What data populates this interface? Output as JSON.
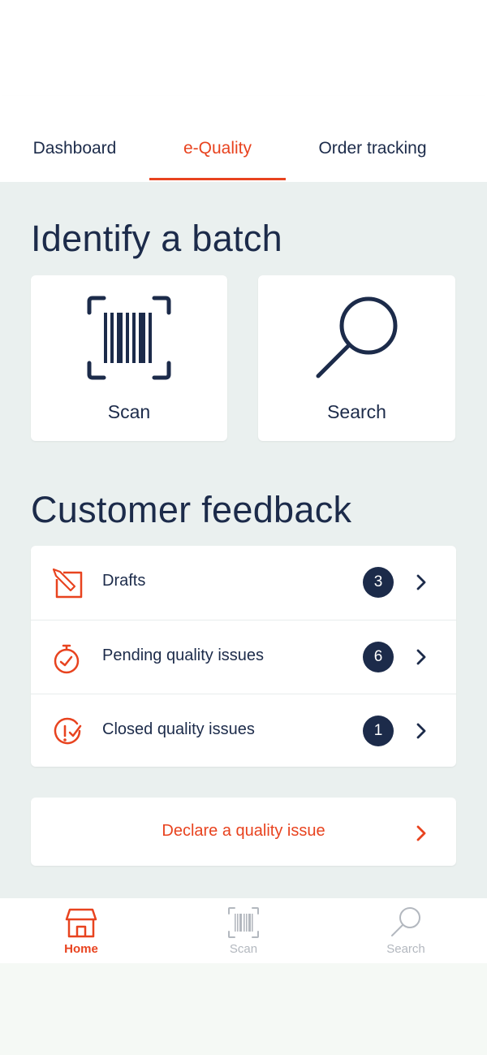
{
  "tabs": [
    {
      "label": "Dashboard",
      "active": false
    },
    {
      "label": "e-Quality",
      "active": true
    },
    {
      "label": "Order tracking",
      "active": false
    }
  ],
  "identify": {
    "title": "Identify a batch",
    "tiles": [
      {
        "label": "Scan",
        "icon": "barcode-scan-icon"
      },
      {
        "label": "Search",
        "icon": "magnifier-icon"
      }
    ]
  },
  "feedback": {
    "title": "Customer feedback",
    "items": [
      {
        "label": "Drafts",
        "count": "3",
        "icon": "draft-edit-icon"
      },
      {
        "label": "Pending quality issues",
        "count": "6",
        "icon": "stopwatch-icon"
      },
      {
        "label": "Closed quality issues",
        "count": "1",
        "icon": "closed-check-icon"
      }
    ]
  },
  "declare": {
    "label": "Declare a quality issue"
  },
  "bottom_nav": [
    {
      "label": "Home",
      "active": true,
      "icon": "home-icon"
    },
    {
      "label": "Scan",
      "active": false,
      "icon": "barcode-scan-icon"
    },
    {
      "label": "Search",
      "active": false,
      "icon": "magnifier-icon"
    }
  ],
  "colors": {
    "accent": "#e8431f",
    "navy": "#1c2b4a",
    "background": "#eaf0ef",
    "battery": "#2bb673"
  }
}
